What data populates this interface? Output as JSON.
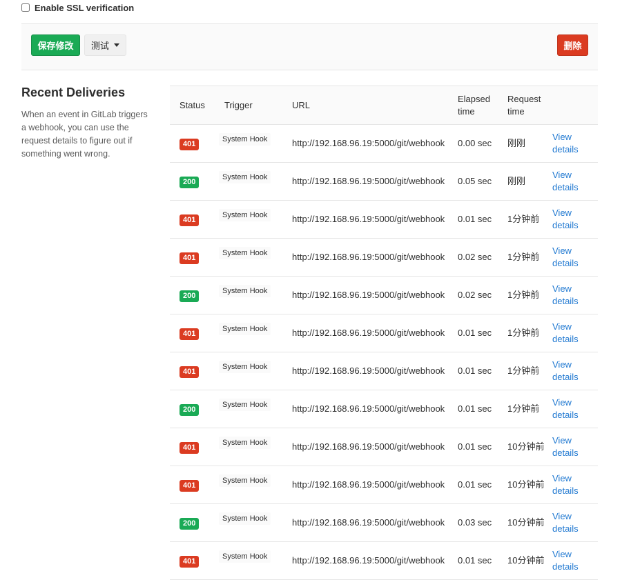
{
  "ssl": {
    "label": "Enable SSL verification",
    "checked": false
  },
  "actions": {
    "save_label": "保存修改",
    "test_label": "测试",
    "delete_label": "删除"
  },
  "sidebar": {
    "title": "Recent Deliveries",
    "description": "When an event in GitLab triggers a webhook, you can use the request details to figure out if something went wrong."
  },
  "table": {
    "headers": {
      "status": "Status",
      "trigger": "Trigger",
      "url": "URL",
      "elapsed": "Elapsed time",
      "request": "Request time"
    },
    "view_label": "View details",
    "rows": [
      {
        "status": "401",
        "kind": "err",
        "trigger": "System Hook",
        "url": "http://192.168.96.19:5000/git/webhook",
        "elapsed": "0.00 sec",
        "request": "刚刚"
      },
      {
        "status": "200",
        "kind": "ok",
        "trigger": "System Hook",
        "url": "http://192.168.96.19:5000/git/webhook",
        "elapsed": "0.05 sec",
        "request": "刚刚"
      },
      {
        "status": "401",
        "kind": "err",
        "trigger": "System Hook",
        "url": "http://192.168.96.19:5000/git/webhook",
        "elapsed": "0.01 sec",
        "request": "1分钟前"
      },
      {
        "status": "401",
        "kind": "err",
        "trigger": "System Hook",
        "url": "http://192.168.96.19:5000/git/webhook",
        "elapsed": "0.02 sec",
        "request": "1分钟前"
      },
      {
        "status": "200",
        "kind": "ok",
        "trigger": "System Hook",
        "url": "http://192.168.96.19:5000/git/webhook",
        "elapsed": "0.02 sec",
        "request": "1分钟前"
      },
      {
        "status": "401",
        "kind": "err",
        "trigger": "System Hook",
        "url": "http://192.168.96.19:5000/git/webhook",
        "elapsed": "0.01 sec",
        "request": "1分钟前"
      },
      {
        "status": "401",
        "kind": "err",
        "trigger": "System Hook",
        "url": "http://192.168.96.19:5000/git/webhook",
        "elapsed": "0.01 sec",
        "request": "1分钟前"
      },
      {
        "status": "200",
        "kind": "ok",
        "trigger": "System Hook",
        "url": "http://192.168.96.19:5000/git/webhook",
        "elapsed": "0.01 sec",
        "request": "1分钟前"
      },
      {
        "status": "401",
        "kind": "err",
        "trigger": "System Hook",
        "url": "http://192.168.96.19:5000/git/webhook",
        "elapsed": "0.01 sec",
        "request": "10分钟前"
      },
      {
        "status": "401",
        "kind": "err",
        "trigger": "System Hook",
        "url": "http://192.168.96.19:5000/git/webhook",
        "elapsed": "0.01 sec",
        "request": "10分钟前"
      },
      {
        "status": "200",
        "kind": "ok",
        "trigger": "System Hook",
        "url": "http://192.168.96.19:5000/git/webhook",
        "elapsed": "0.03 sec",
        "request": "10分钟前"
      },
      {
        "status": "401",
        "kind": "err",
        "trigger": "System Hook",
        "url": "http://192.168.96.19:5000/git/webhook",
        "elapsed": "0.01 sec",
        "request": "10分钟前"
      }
    ]
  },
  "colors": {
    "success": "#1aaa55",
    "danger": "#db3b21",
    "link": "#1f78d1"
  }
}
